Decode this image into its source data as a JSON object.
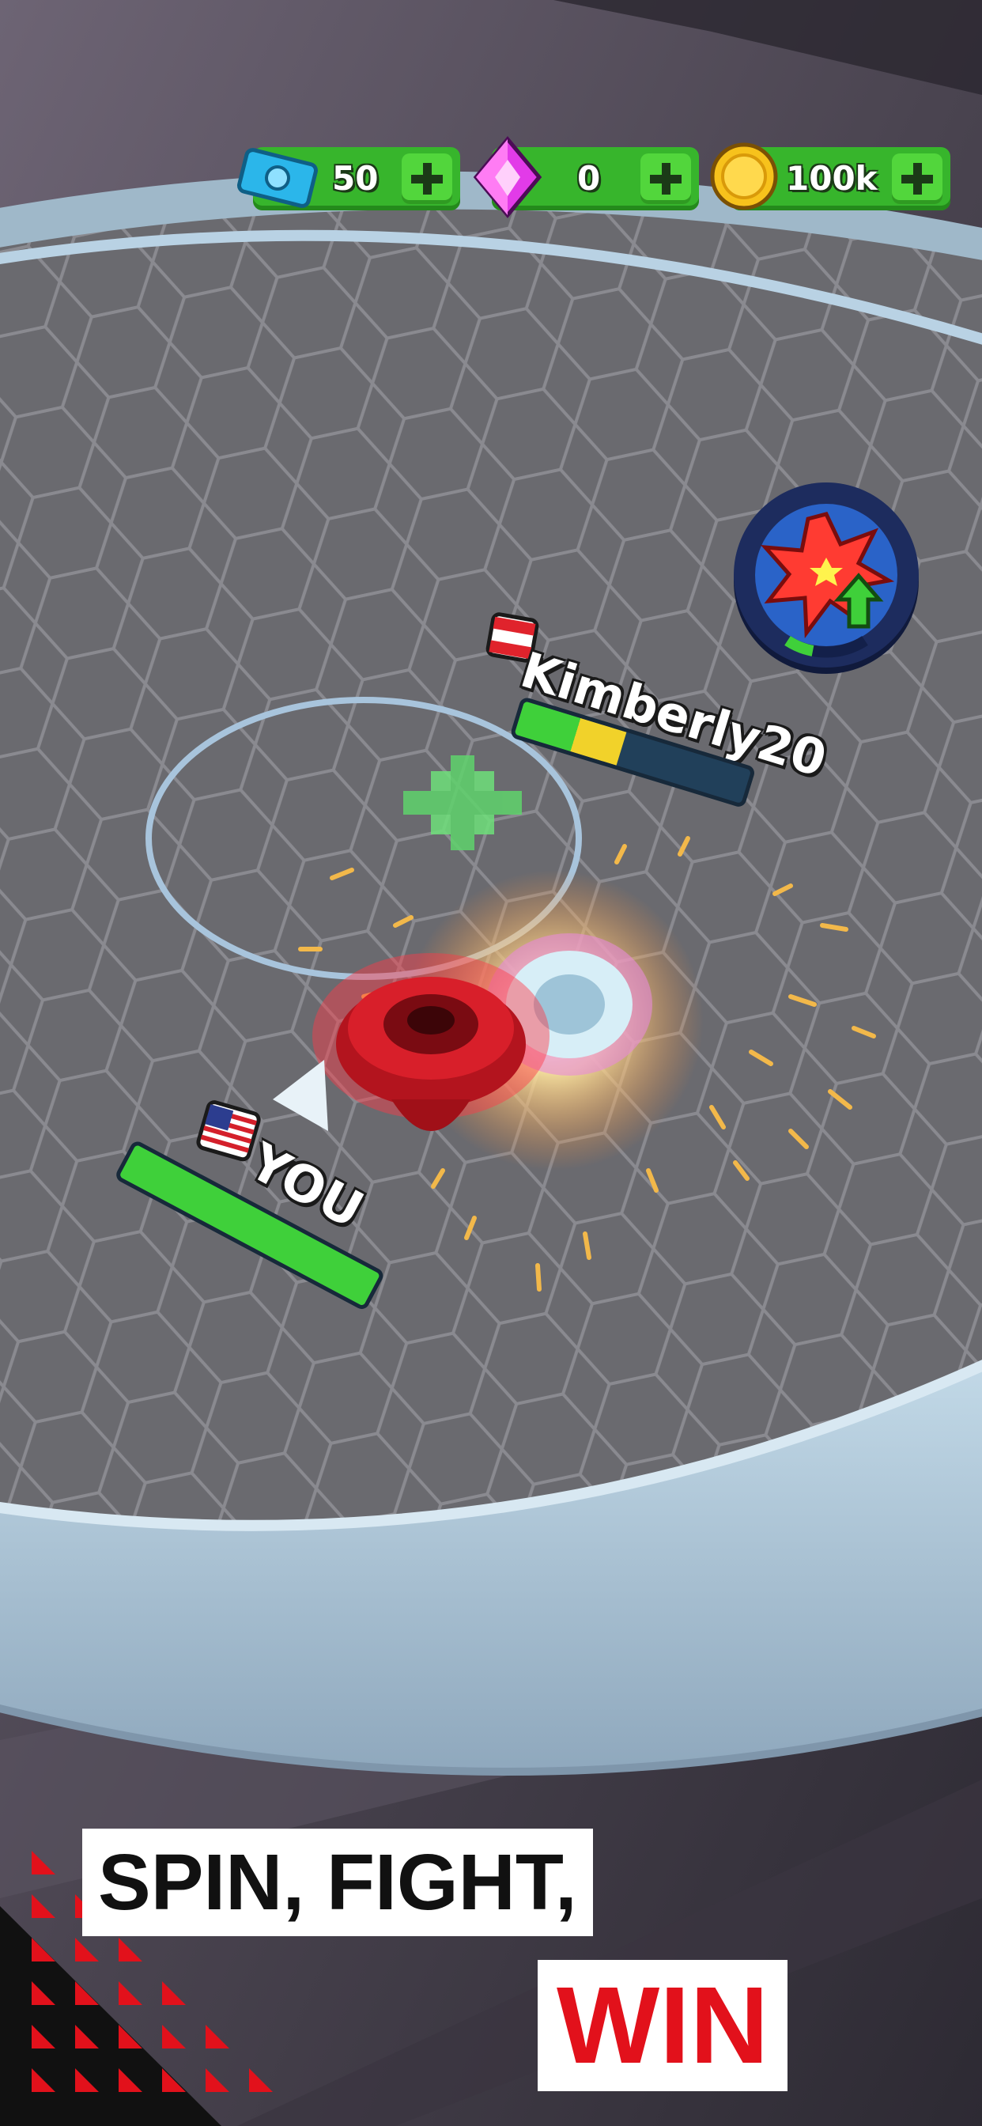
{
  "currency": {
    "tickets": {
      "value": "50",
      "icon": "ticket-icon"
    },
    "gems": {
      "value": "0",
      "icon": "gem-icon"
    },
    "coins": {
      "value": "100k",
      "icon": "coin-icon"
    }
  },
  "opponent": {
    "name": "Kimberly20",
    "flag": "austria-flag-icon",
    "health": 0.45
  },
  "player": {
    "name": "YOU",
    "flag": "usa-flag-icon",
    "health": 1.0
  },
  "ability": {
    "icon": "power-attack-icon",
    "charge": 0.25
  },
  "slogan": {
    "line1": "SPIN, FIGHT,",
    "line2": "WIN"
  },
  "colors": {
    "accent": "#e2111b",
    "bar_green": "#37b52c",
    "arena": "#6b6b70"
  }
}
